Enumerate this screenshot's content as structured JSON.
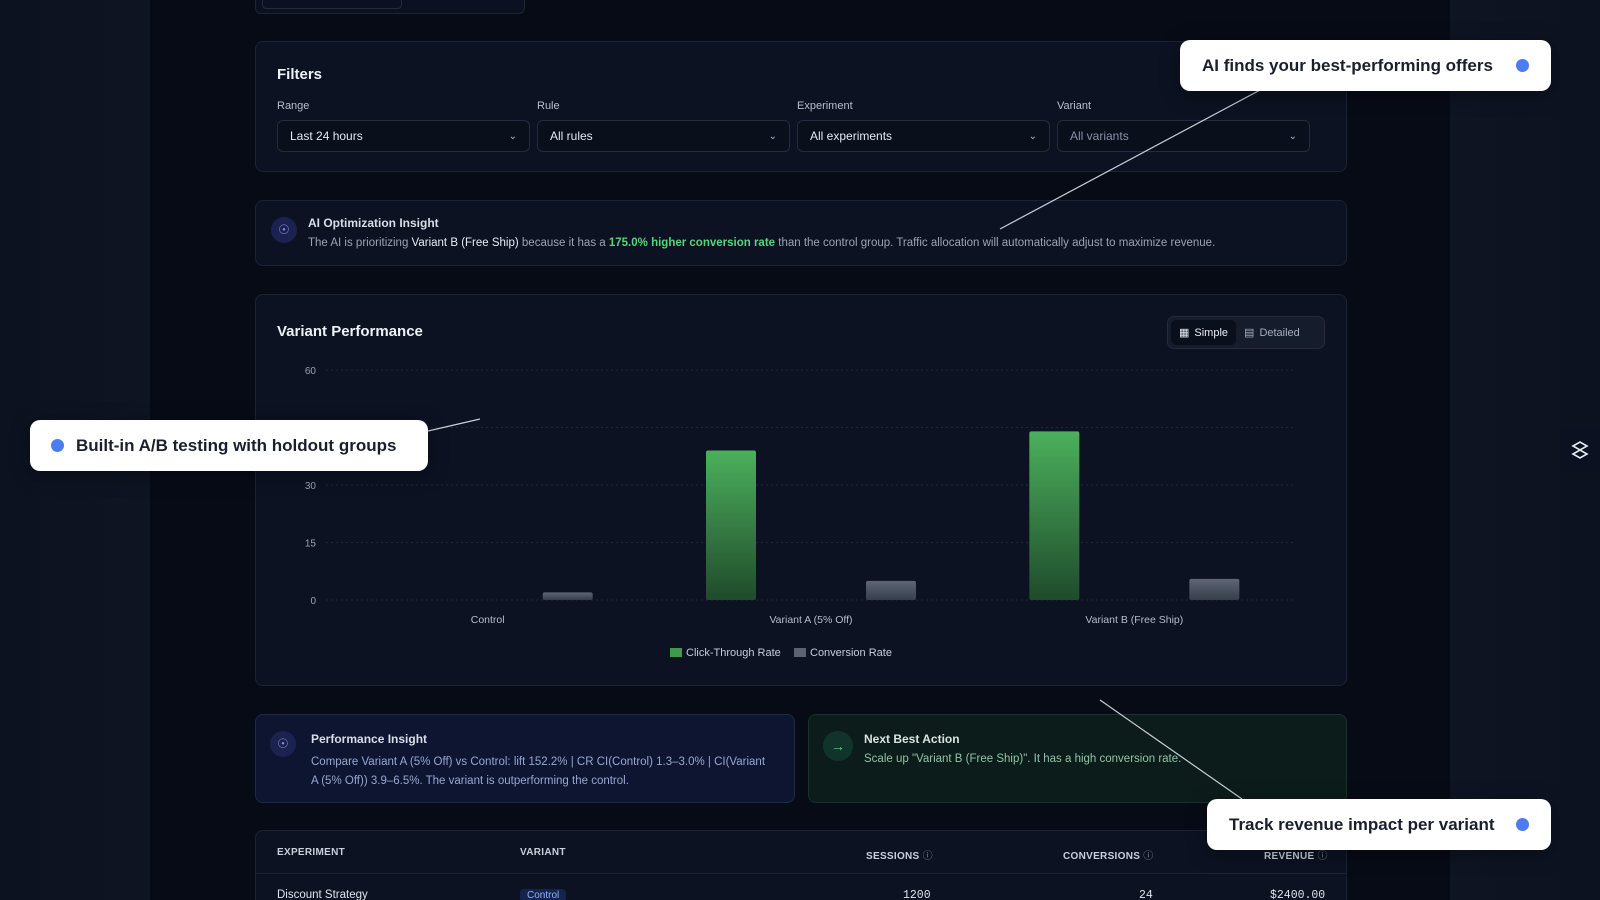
{
  "filters": {
    "title": "Filters",
    "range": {
      "label": "Range",
      "value": "Last 24 hours"
    },
    "rule": {
      "label": "Rule",
      "value": "All rules"
    },
    "experiment": {
      "label": "Experiment",
      "value": "All experiments"
    },
    "variant": {
      "label": "Variant",
      "value": "All variants"
    }
  },
  "ai_insight": {
    "title": "AI Optimization Insight",
    "text_prefix": "The AI is prioritizing ",
    "variant": "Variant B (Free Ship)",
    "text_mid": " because it has a ",
    "highlight": "175.0% higher conversion rate",
    "text_suffix": " than the control group. Traffic allocation will automatically adjust to maximize revenue.",
    "icon": "lightbulb-icon"
  },
  "performance": {
    "title": "Variant Performance",
    "toggle": {
      "simple": "Simple",
      "detailed": "Detailed",
      "active": "simple"
    }
  },
  "chart_data": {
    "type": "bar",
    "categories": [
      "Control",
      "Variant A (5% Off)",
      "Variant B (Free Ship)"
    ],
    "series": [
      {
        "name": "Click-Through Rate",
        "values": [
          0,
          39,
          44
        ],
        "color": "#3f9a4d"
      },
      {
        "name": "Conversion Rate",
        "values": [
          2.0,
          5.0,
          5.5
        ],
        "color": "#5b6372"
      }
    ],
    "y_ticks": [
      0,
      15,
      30,
      45,
      60
    ],
    "y_tick_labels": [
      "0",
      "15",
      "30",
      "",
      "60"
    ],
    "ylim": [
      0,
      60
    ],
    "grid": true,
    "legend_position": "bottom"
  },
  "performance_insight": {
    "title": "Performance Insight",
    "text": "Compare Variant A (5% Off) vs Control: lift 152.2% | CR CI(Control) 1.3–3.0% | CI(Variant A (5% Off)) 3.9–6.5%. The variant is outperforming the control.",
    "icon": "lightbulb-icon"
  },
  "next_best_action": {
    "title": "Next Best Action",
    "text": "Scale up \"Variant B (Free Ship)\". It has a high conversion rate.",
    "icon": "arrow-right-icon"
  },
  "table": {
    "headers": {
      "experiment": "EXPERIMENT",
      "variant": "VARIANT",
      "sessions": "SESSIONS",
      "conversions": "CONVERSIONS",
      "revenue": "REVENUE"
    },
    "rows": [
      {
        "experiment": "Discount Strategy",
        "variant": "Control",
        "sessions": "1200",
        "conversions": "24",
        "revenue": "$2400.00"
      }
    ]
  },
  "callouts": {
    "top": "AI finds your best-performing offers",
    "left": "Built-in A/B testing with holdout groups",
    "bottom": "Track revenue impact per variant"
  },
  "colors": {
    "accent": "#4c7cf0",
    "green": "#58d47a"
  }
}
